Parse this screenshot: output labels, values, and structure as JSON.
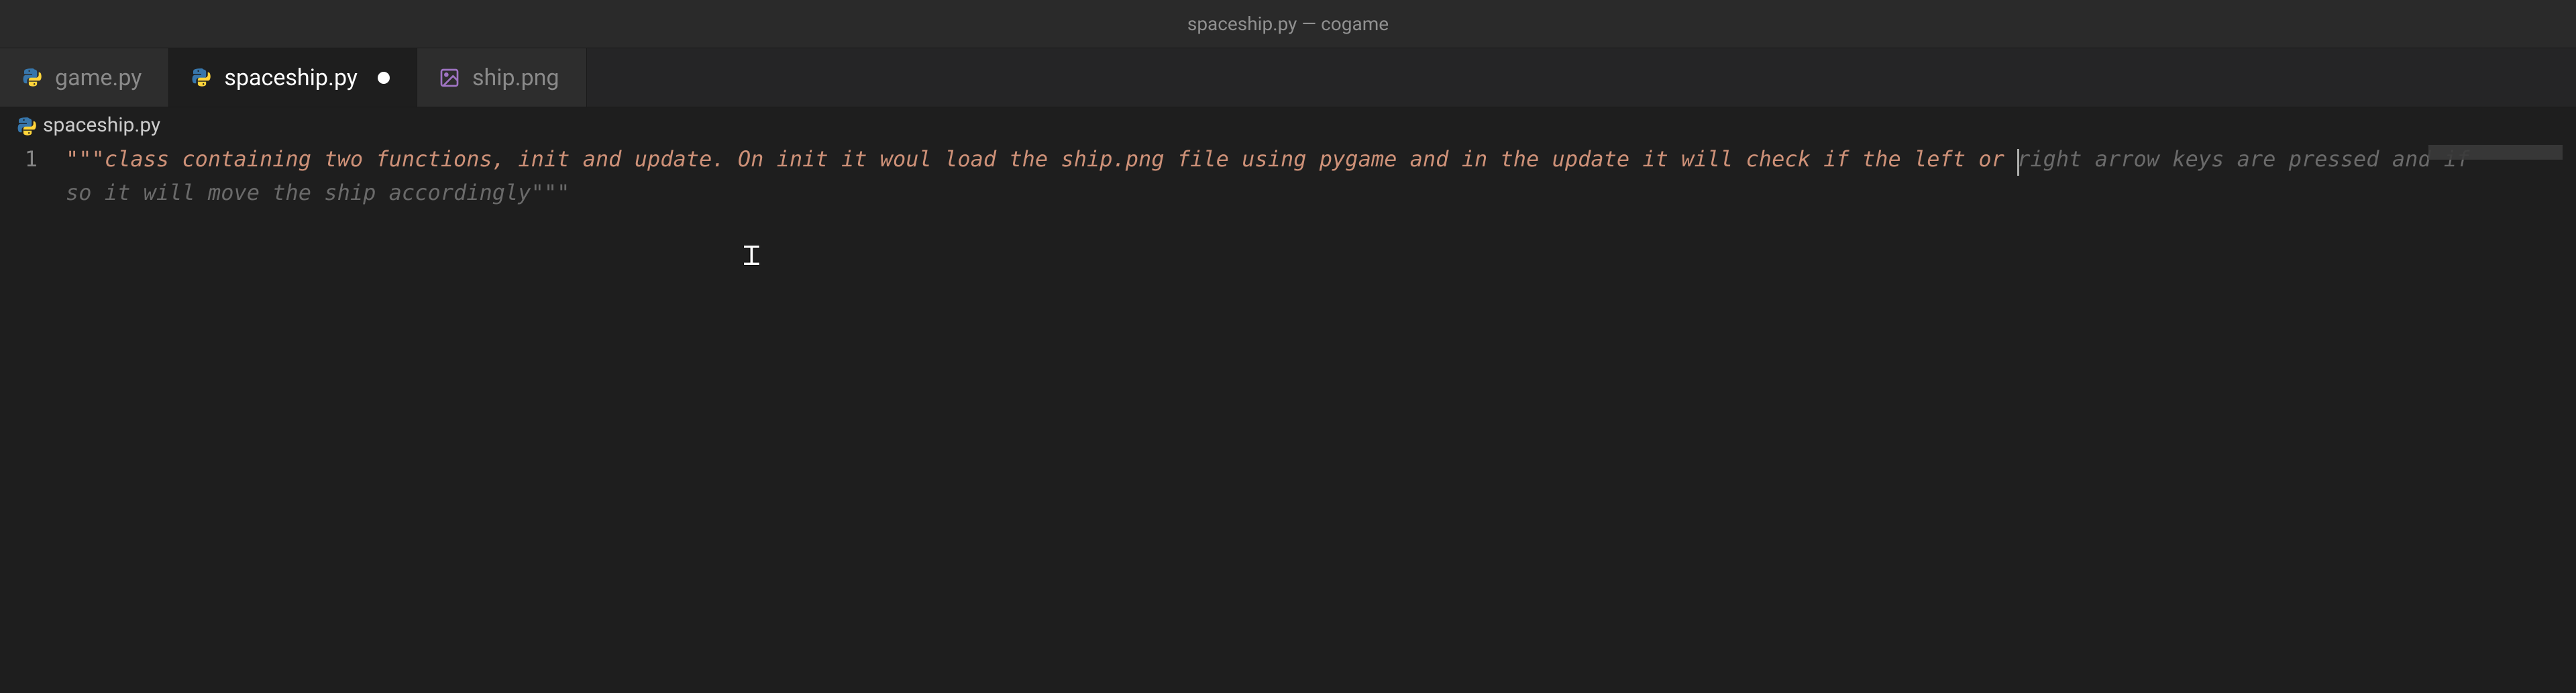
{
  "window": {
    "title": "spaceship.py — cogame"
  },
  "tabs": [
    {
      "label": "game.py",
      "icon": "python",
      "active": false,
      "modified": false,
      "kind": "py"
    },
    {
      "label": "spaceship.py",
      "icon": "python",
      "active": true,
      "modified": true,
      "kind": "py"
    },
    {
      "label": "ship.png",
      "icon": "image",
      "active": false,
      "modified": false,
      "kind": "png"
    }
  ],
  "breadcrumb": {
    "icon": "python",
    "path": "spaceship.py"
  },
  "editor": {
    "line_number": "1",
    "triple_quote": "\"\"\"",
    "typed_text": "class containing two functions, init and update. On init it woul load the ship.png file using pygame and in the update it will check if the left or ",
    "suggestion_text": "right arrow keys are pressed and if so it will move the ship accordingly",
    "closing_quote": "\"\"\""
  }
}
